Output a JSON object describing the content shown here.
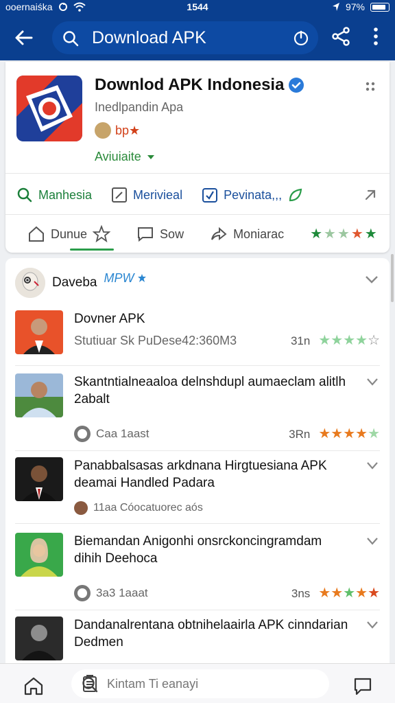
{
  "status_bar": {
    "carrier": "ᴏoernaiśka",
    "time": "1544",
    "battery": "97%",
    "battery_level": 0.97
  },
  "app_bar": {
    "search_text": "Download APK",
    "icons": [
      "back-arrow-icon",
      "search-icon",
      "power-icon",
      "share-icon",
      "more-vert-icon"
    ]
  },
  "app": {
    "title": "Downlod APK Indonesia",
    "subtitle": "Inedlpandin Apa",
    "developer": "bp★",
    "availability": "Aviuiaite",
    "actions": [
      {
        "label": "Manhesia",
        "icon": "search-icon"
      },
      {
        "label": "Merivieal",
        "icon": "edit-icon"
      },
      {
        "label": "Pevinata,,,",
        "icon": "check-square-icon"
      }
    ],
    "ratings": [
      {
        "label": "Dunue",
        "icon": "home-icon"
      },
      {
        "label": "Sow",
        "icon": "comment-icon"
      },
      {
        "label": "Moniarac",
        "icon": "share-icon"
      }
    ],
    "stars": [
      "#1e8a3a",
      "#9cc7a0",
      "#9cc7a0",
      "#e0572e",
      "#1e8a3a"
    ]
  },
  "feed": {
    "author": "Daveba",
    "tag": "MPW",
    "items": [
      {
        "title": "Dovner APK",
        "subtitle": "Stutiuar Sk PuDese42:360M3",
        "rating_label": "31n",
        "stars": [
          "#8fd39c",
          "#8fd39c",
          "#8fd39c",
          "#8fd39c",
          "#ffffff"
        ]
      },
      {
        "title": "Skantntialneaaloa delnshdupl aumaeclam alitlh 2abalt",
        "meta": "Caa 1aast",
        "rating_label": "3Rn",
        "stars": [
          "#e87a1e",
          "#e87a1e",
          "#e87a1e",
          "#e87a1e",
          "#9fd8a6"
        ]
      },
      {
        "title": "Panabbalsasas arkdnana Hirgtuesiana APK deamai Handled Padara",
        "meta": "11aa Cóocatuorec aós"
      },
      {
        "title": "Biemandan Anigonhi onsrckoncingramdam dihih Deehoca",
        "meta": "3a3 1aaat",
        "rating_label": "3ns",
        "stars": [
          "#e87a1e",
          "#e87a1e",
          "#5fbf6a",
          "#e87a1e",
          "#d94a1e"
        ]
      },
      {
        "title": "Dandanalrentana obtnihelaairla APK cinndarian Dedmen"
      }
    ]
  },
  "bottom_nav": {
    "search_placeholder": "Kintam Ti eanayi",
    "icons": [
      "home-icon",
      "search-icon",
      "document-icon",
      "chat-icon"
    ]
  },
  "colors": {
    "app_bar": "#0a3f8f",
    "accent_green": "#2a8a3a",
    "link_blue": "#1a4f9c",
    "developer_orange": "#d2411a"
  }
}
